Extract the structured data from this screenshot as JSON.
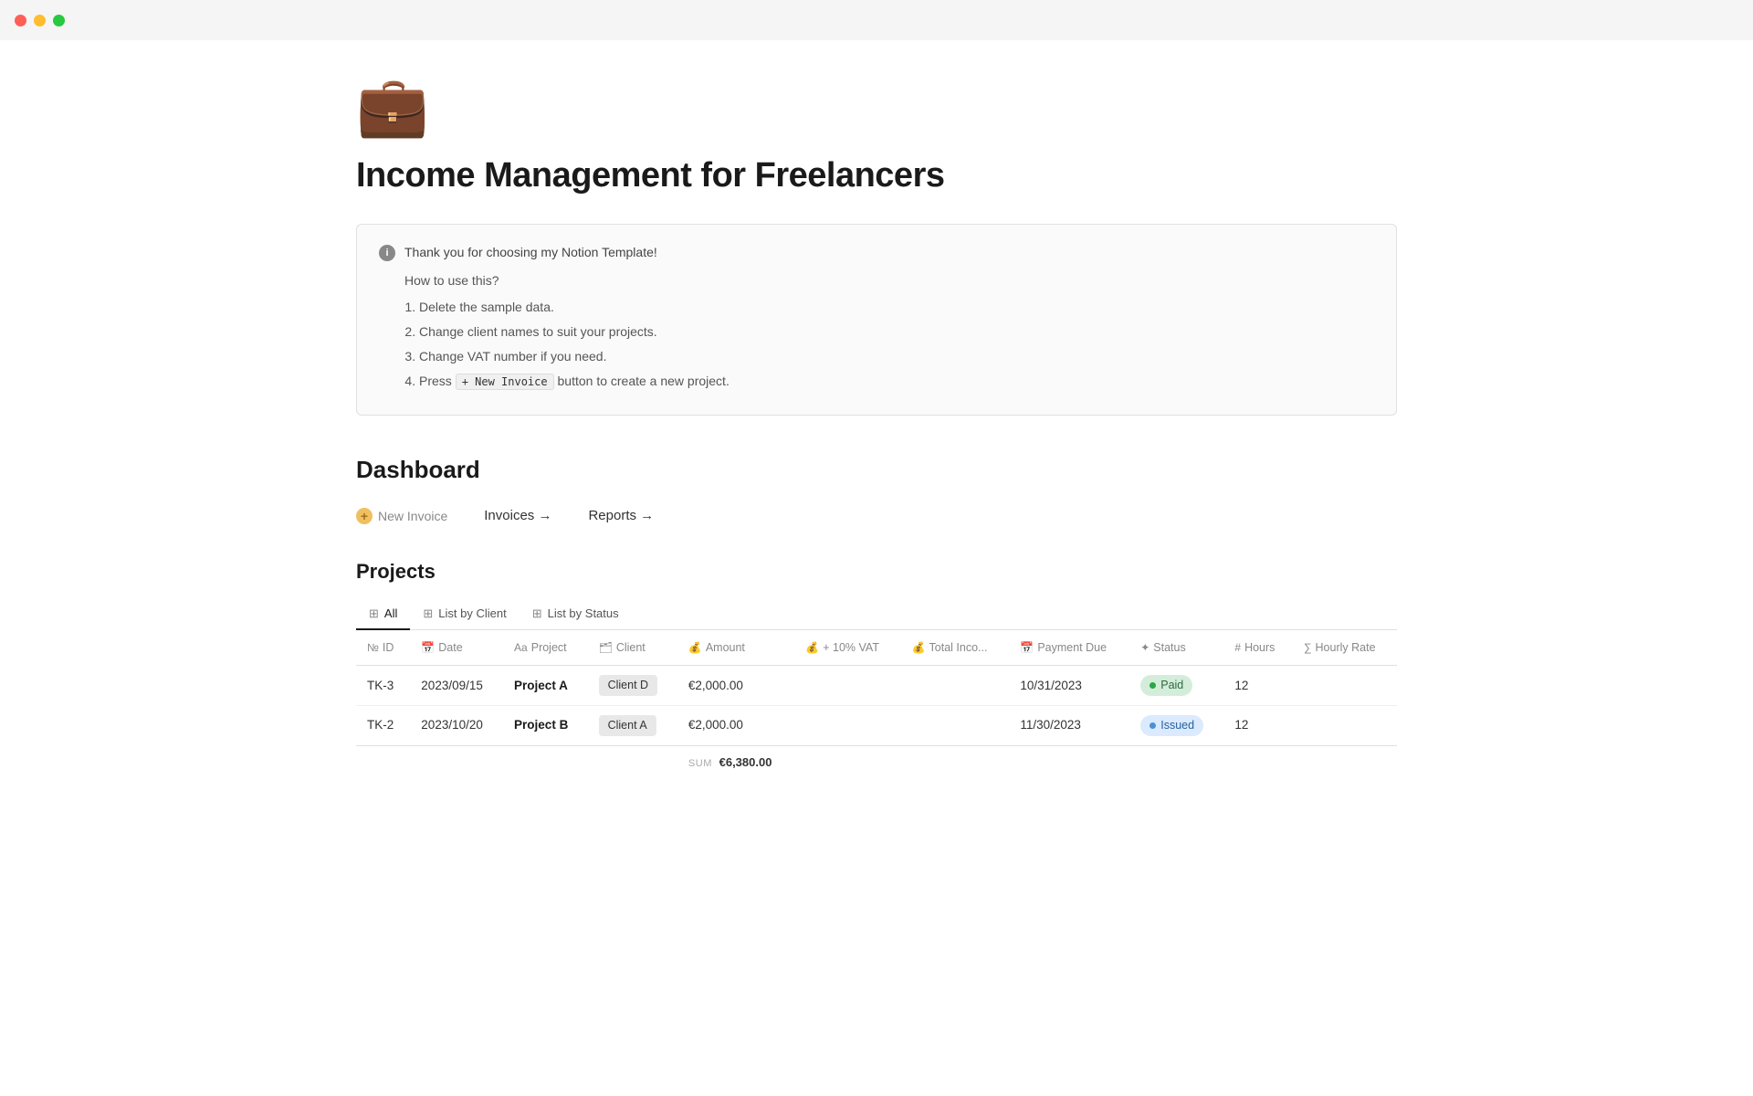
{
  "titlebar": {
    "lights": [
      "red",
      "yellow",
      "green"
    ]
  },
  "page": {
    "icon": "💼",
    "title": "Income Management for Freelancers"
  },
  "infobox": {
    "header_text": "Thank you for choosing my Notion Template!",
    "subheader": "How to use this?",
    "steps": [
      "Delete the sample data.",
      "Change client names to suit your projects.",
      "Change VAT number if you need.",
      "Press"
    ],
    "step4_code": "+ New Invoice",
    "step4_suffix": "button to create a new project."
  },
  "dashboard": {
    "title": "Dashboard",
    "new_invoice_label": "New Invoice",
    "links": [
      {
        "label": "Invoices →"
      },
      {
        "label": "Reports →"
      }
    ]
  },
  "projects": {
    "title": "Projects",
    "tabs": [
      {
        "label": "All",
        "icon": "⊞",
        "active": true
      },
      {
        "label": "List by Client",
        "icon": "⊞"
      },
      {
        "label": "List by Status",
        "icon": "⊞"
      }
    ],
    "columns": [
      {
        "icon": "№",
        "label": "ID"
      },
      {
        "icon": "📅",
        "label": "Date"
      },
      {
        "icon": "Aa",
        "label": "Project"
      },
      {
        "icon": "🗂",
        "label": "Client"
      },
      {
        "icon": "💰",
        "label": "Amount"
      },
      {
        "icon": "💰",
        "label": "+ 10% VAT"
      },
      {
        "icon": "💰",
        "label": "Total Inco..."
      },
      {
        "icon": "📅",
        "label": "Payment Due"
      },
      {
        "icon": "✦",
        "label": "Status"
      },
      {
        "icon": "#",
        "label": "Hours"
      },
      {
        "icon": "∑",
        "label": "Hourly Rate"
      }
    ],
    "rows": [
      {
        "id": "TK-3",
        "date": "2023/09/15",
        "project": "Project A",
        "client": "Client D",
        "amount": "€2,000.00",
        "vat": "",
        "total": "",
        "payment_due": "10/31/2023",
        "status": "Paid",
        "status_type": "paid",
        "hours": "12",
        "hourly_rate": ""
      },
      {
        "id": "TK-2",
        "date": "2023/10/20",
        "project": "Project B",
        "client": "Client A",
        "amount": "€2,000.00",
        "vat": "",
        "total": "",
        "payment_due": "11/30/2023",
        "status": "Issued",
        "status_type": "issued",
        "hours": "12",
        "hourly_rate": ""
      }
    ],
    "sum_label": "SUM",
    "sum_value": "€6,380.00"
  }
}
